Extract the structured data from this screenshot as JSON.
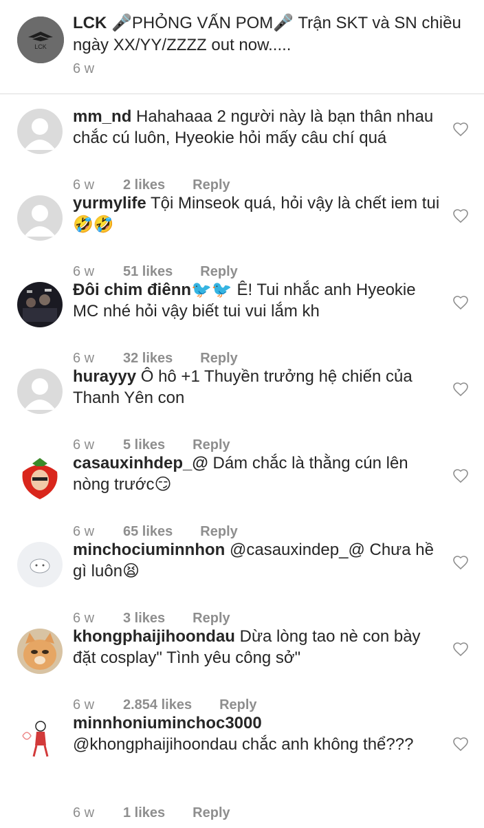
{
  "caption": {
    "username": "LCK",
    "text": " 🎤PHỎNG VẤN POM🎤 Trận SKT và SN chiều ngày XX/YY/ZZZZ out now.....",
    "time": "6 w",
    "avatar_label": "LCK"
  },
  "comments": [
    {
      "username": "mm_nd",
      "text": " Hahahaaa 2 người này là bạn thân nhau chắc cú luôn, Hyeokie hỏi mấy câu chí quá",
      "time": "6 w",
      "likes": "2 likes",
      "reply": "Reply",
      "avatar": "default"
    },
    {
      "username": "yurmylife",
      "text": " Tội Minseok quá, hỏi vậy là chết iem tui 🤣🤣",
      "time": "6 w",
      "likes": "51 likes",
      "reply": "Reply",
      "avatar": "default"
    },
    {
      "username": "Đôi chim điênn🐦🐦",
      "text": " Ê! Tui nhắc anh Hyeokie MC nhé hỏi vậy biết tui vui lắm kh",
      "time": "6 w",
      "likes": "32 likes",
      "reply": "Reply",
      "avatar": "photo-dark"
    },
    {
      "username": "hurayyy",
      "text": " Ô hô +1 Thuyền trưởng hệ chiến của Thanh Yên con",
      "time": "6 w",
      "likes": "5 likes",
      "reply": "Reply",
      "avatar": "default"
    },
    {
      "username": "casauxinhdep_@",
      "text": " Dám chắc là thằng cún lên nòng trước😏",
      "time": "6 w",
      "likes": "65 likes",
      "reply": "Reply",
      "avatar": "photo-strawberry"
    },
    {
      "username": "minchociuminnhon",
      "text": " @casauxindep_@ Chưa hề gì luôn😫",
      "time": "6 w",
      "likes": "3 likes",
      "reply": "Reply",
      "avatar": "photo-white"
    },
    {
      "username": "khongphaijihoondau",
      "text": " Dừa lòng tao nè con bày đặt cosplay\" Tình yêu công sở\"",
      "time": "6 w",
      "likes": "2.854 likes",
      "reply": "Reply",
      "avatar": "photo-cat"
    },
    {
      "username": "minnhoniuminchoc3000",
      "text": "@khongphaijihoondau chắc anh không thể???",
      "time": "6 w",
      "likes": "1 likes",
      "reply": "Reply",
      "avatar": "photo-drawing"
    }
  ],
  "colors": {
    "text": "#262626",
    "muted": "#8e8e8e",
    "divider": "#dbdbdb",
    "avatar_default": "#dbdbdb"
  }
}
